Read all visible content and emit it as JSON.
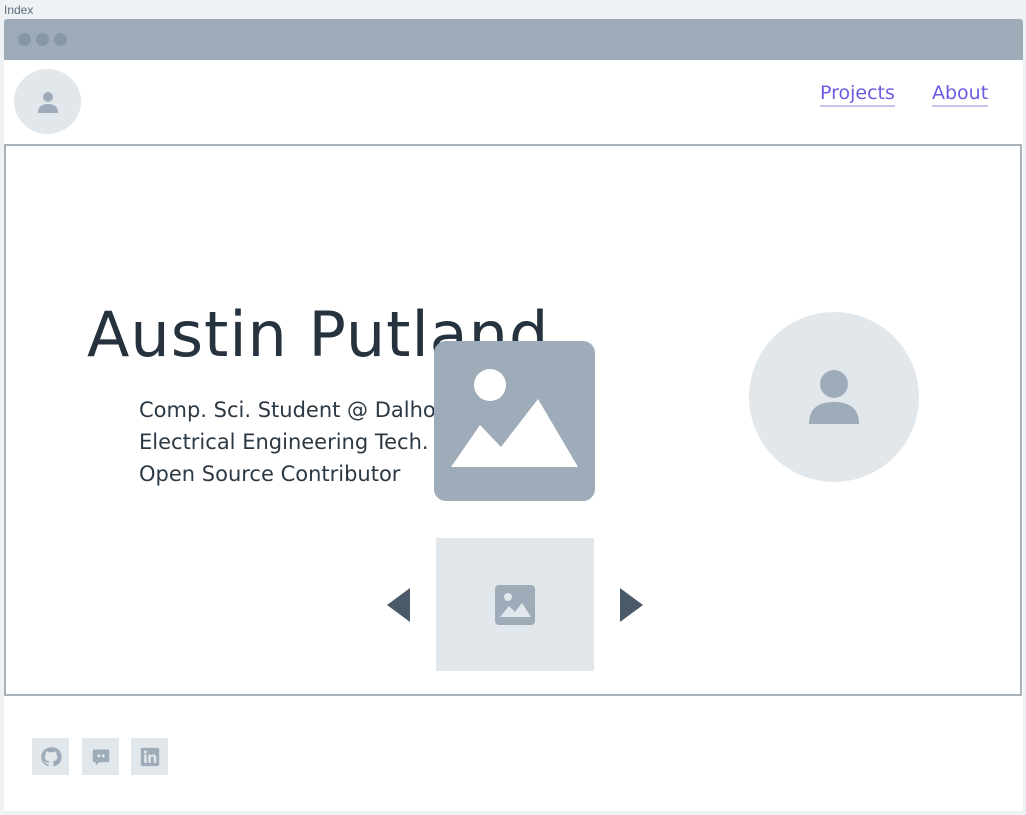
{
  "page": {
    "label": "Index"
  },
  "nav": {
    "projects_label": "Projects",
    "about_label": "About"
  },
  "hero": {
    "name": "Austin Putland",
    "lines": [
      "Comp. Sci. Student @ Dalhousie",
      "Electrical Engineering Tech.",
      "Open Source Contributor"
    ]
  },
  "icons": {
    "logo": "user-icon",
    "hero_image": "image-placeholder-icon",
    "hero_avatar": "user-icon",
    "carousel_prev": "triangle-left-icon",
    "carousel_next": "triangle-right-icon",
    "carousel_slide": "image-icon",
    "socials": [
      "github-icon",
      "discord-icon",
      "linkedin-icon"
    ]
  },
  "colors": {
    "link": "#6a5be0",
    "placeholder": "#9dacb8",
    "placeholder_light": "#e2e7eb",
    "text": "#26333f"
  }
}
